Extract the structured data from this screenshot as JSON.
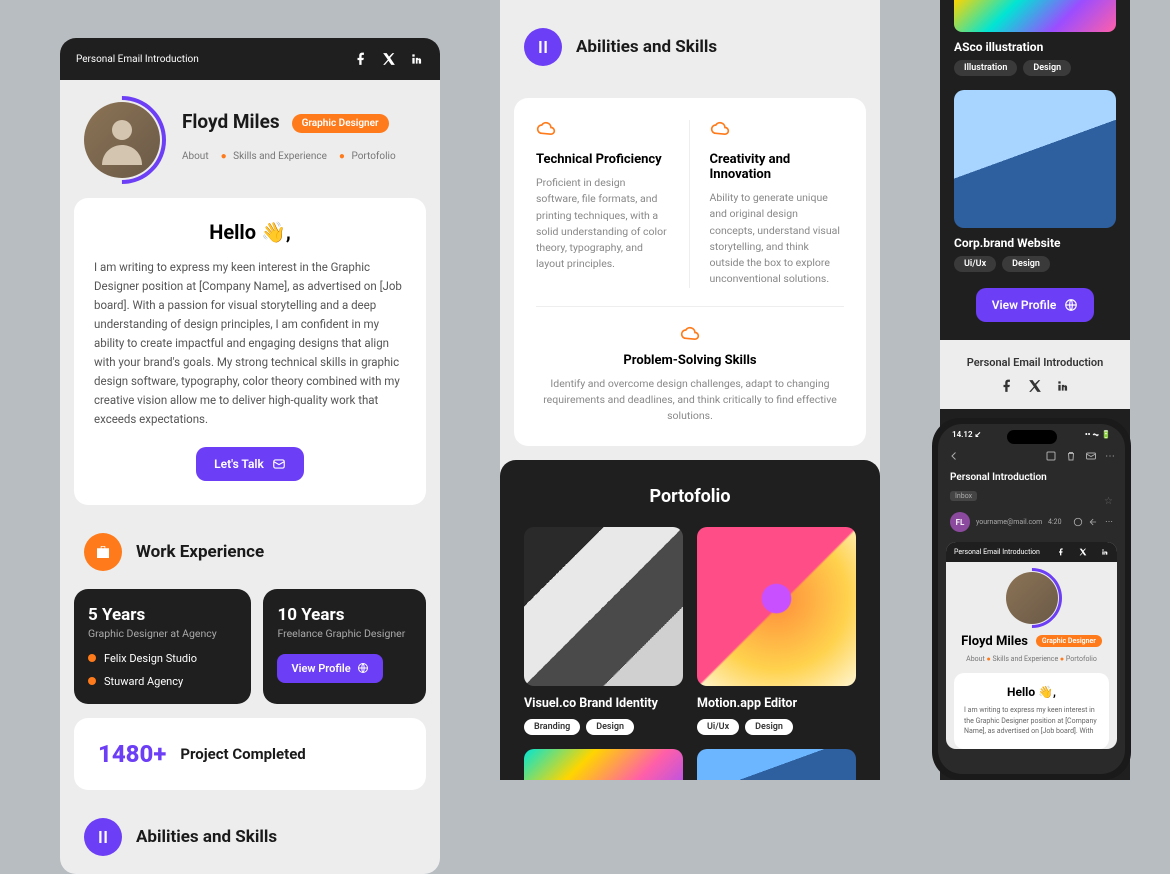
{
  "topbar": {
    "title": "Personal Email Introduction"
  },
  "hero": {
    "name": "Floyd Miles",
    "badge": "Graphic Designer",
    "nav": [
      "About",
      "Skills and Experience",
      "Portofolio"
    ]
  },
  "intro": {
    "hello": "Hello 👋,",
    "text": "I am writing to express my keen interest in the Graphic Designer position at [Company Name], as advertised on [Job board].  With a passion for visual storytelling and a deep understanding of design principles, I am confident in my ability to create impactful and engaging designs that align with your brand's goals. My strong technical skills in graphic design software, typography, color theory combined with my creative vision allow me to deliver high-quality work that exceeds expectations.",
    "cta": "Let's Talk"
  },
  "work": {
    "title": "Work Experience",
    "card1": {
      "years": "5 Years",
      "role": "Graphic Designer at Agency",
      "items": [
        "Felix Design Studio",
        "Stuward Agency"
      ]
    },
    "card2": {
      "years": "10 Years",
      "role": "Freelance Graphic Designer",
      "btn": "View Profile"
    }
  },
  "stat": {
    "n": "1480+",
    "l": "Project Completed"
  },
  "skills": {
    "title": "Abilities and Skills",
    "c1": {
      "t": "Technical Proficiency",
      "d": "Proficient in design software, file formats, and printing techniques, with a solid understanding of color theory, typography, and layout principles."
    },
    "c2": {
      "t": "Creativity and Innovation",
      "d": "Ability to generate unique and original design concepts, understand visual storytelling, and think outside the box to explore unconventional solutions."
    },
    "c3": {
      "t": "Problem-Solving Skills",
      "d": "Identify and overcome design challenges, adapt to changing requirements and deadlines, and think critically to find effective solutions."
    }
  },
  "port": {
    "title": "Portofolio",
    "i1": {
      "name": "Visuel.co Brand Identity",
      "tags": [
        "Branding",
        "Design"
      ]
    },
    "i2": {
      "name": "Motion.app Editor",
      "tags": [
        "Ui/Ux",
        "Design"
      ]
    }
  },
  "right": {
    "i1": {
      "name": "ASco illustration",
      "tags": [
        "Illustration",
        "Design"
      ]
    },
    "i2": {
      "name": "Corp.brand Website",
      "tags": [
        "Ui/Ux",
        "Design"
      ]
    },
    "btn": "View Profile",
    "foot": "Personal Email Introduction"
  },
  "phone": {
    "time": "14.12 ↙",
    "subject": "Personal Introduction",
    "inbox": "Inbox",
    "from": "yourname@mail.com",
    "fromTime": "4:20",
    "av": "FL",
    "topbar": "Personal Email Introduction",
    "name": "Floyd Miles",
    "badge": "Graphic Designer",
    "nav": [
      "About",
      "Skills and Experience",
      "Portofolio"
    ],
    "hello": "Hello 👋,",
    "text": "I am writing to express my keen interest in the Graphic Designer position at [Company Name], as advertised on [Job board]. With"
  }
}
